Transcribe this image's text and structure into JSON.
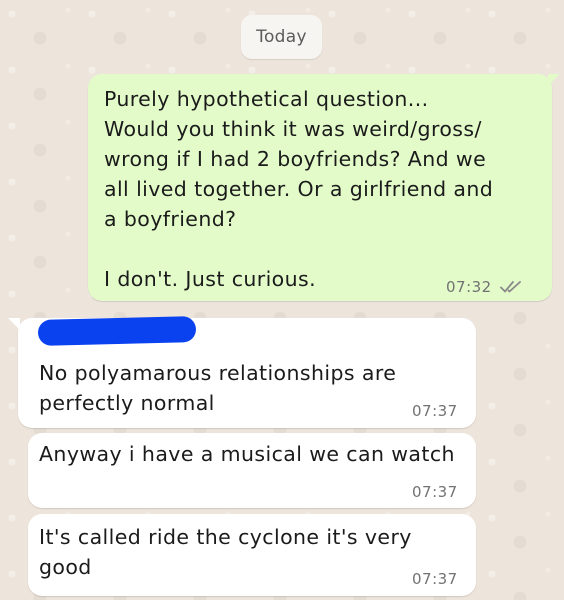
{
  "chat": {
    "date_label": "Today",
    "messages": [
      {
        "direction": "outgoing",
        "text": "Purely hypothetical question...\nWould you think it was weird/gross/\nwrong if I had 2 boyfriends? And we\nall lived together. Or a girlfriend and\na boyfriend?\n\nI don't. Just curious.",
        "time": "07:32",
        "status_icon": "double-check-icon"
      },
      {
        "direction": "incoming",
        "text": "No polyamarous relationships are\nperfectly normal",
        "time": "07:37"
      },
      {
        "direction": "incoming",
        "text": "Anyway i have a musical we can watch",
        "time": "07:37"
      },
      {
        "direction": "incoming",
        "text": "It's called ride the cyclone it's very\ngood",
        "time": "07:37"
      }
    ]
  },
  "colors": {
    "wallpaper": "#ede5dc",
    "outgoing_bubble": "#e2fbc9",
    "incoming_bubble": "#ffffff",
    "redaction": "#0b42f0",
    "timestamp": "#727272"
  }
}
